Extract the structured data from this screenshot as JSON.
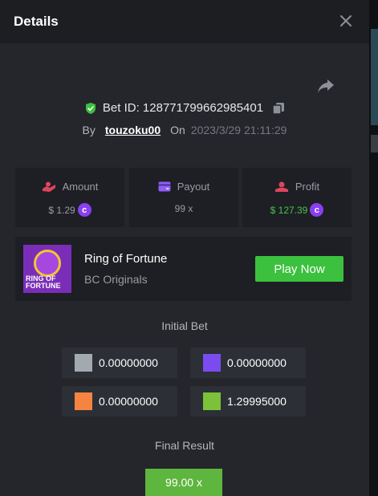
{
  "modal": {
    "title": "Details"
  },
  "bet": {
    "id_label": "Bet ID: 128771799662985401",
    "by_label": "By",
    "username": "touzoku00",
    "on_label": "On",
    "timestamp": "2023/3/29 21:11:29"
  },
  "stats": {
    "amount": {
      "label": "Amount",
      "value": "$ 1.29",
      "icon": "hand-coins-icon"
    },
    "payout": {
      "label": "Payout",
      "value": "99 x",
      "icon": "card-icon"
    },
    "profit": {
      "label": "Profit",
      "value": "$ 127.39",
      "icon": "profit-icon",
      "color": "#47c448"
    }
  },
  "game": {
    "title": "Ring of Fortune",
    "subtitle": "BC Originals",
    "play_label": "Play Now",
    "thumb_text": "RING OF FORTUNE"
  },
  "initial_bet": {
    "title": "Initial Bet",
    "cells": [
      {
        "value": "0.00000000",
        "color": "#a3a9b0"
      },
      {
        "value": "0.00000000",
        "color": "#7a4cf0"
      },
      {
        "value": "0.00000000",
        "color": "#f58442"
      },
      {
        "value": "1.29995000",
        "color": "#7cc13a"
      }
    ]
  },
  "final_result": {
    "title": "Final Result",
    "value": "99.00 x",
    "color": "#5fb63f"
  },
  "colors": {
    "accent_green": "#3bc13d",
    "coin_purple": "#8a3ff0",
    "background": "#24262b"
  }
}
